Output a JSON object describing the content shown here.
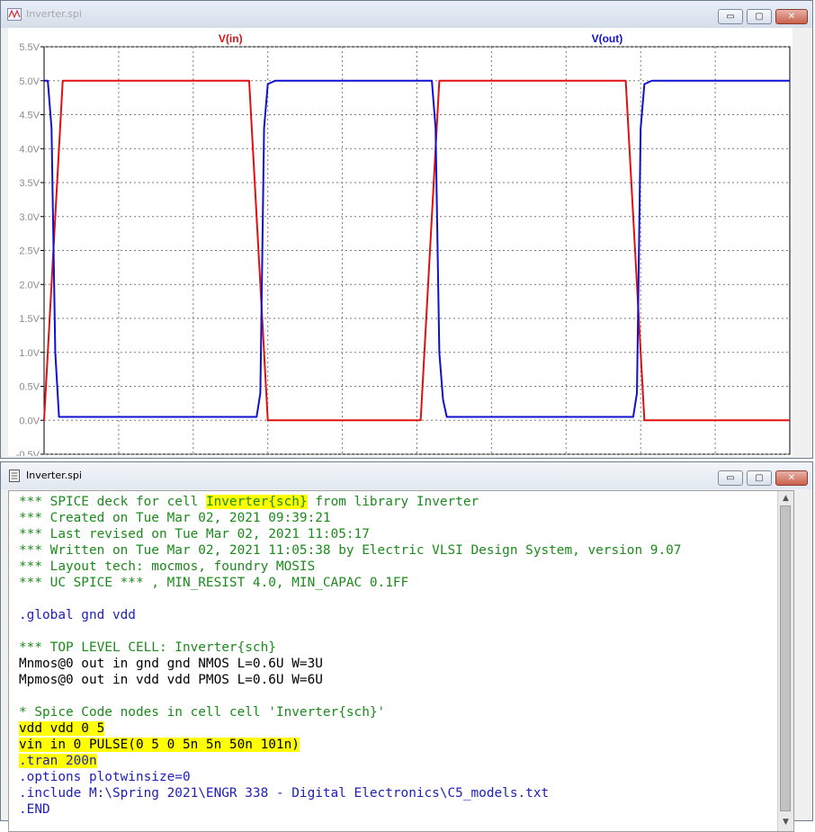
{
  "waveform_window": {
    "title": "Inverter.spi",
    "buttons": {
      "minimize": "▭",
      "restore": "▢",
      "close": "✕"
    },
    "traces": [
      {
        "name": "V(in)",
        "color": "#e01010"
      },
      {
        "name": "V(out)",
        "color": "#1010d0"
      }
    ],
    "background": "#ffffff",
    "grid_color": "#7a7a7a"
  },
  "chart_data": {
    "type": "line",
    "grid": true,
    "x_unit": "ns",
    "xlim": [
      0,
      200
    ],
    "ylim": [
      -0.5,
      5.5
    ],
    "y_ticks": [
      "5.5V",
      "5.0V",
      "4.5V",
      "4.0V",
      "3.5V",
      "3.0V",
      "2.5V",
      "2.0V",
      "1.5V",
      "1.0V",
      "0.5V",
      "0.0V",
      "-0.5V"
    ],
    "y_tick_values": [
      5.5,
      5.0,
      4.5,
      4.0,
      3.5,
      3.0,
      2.5,
      2.0,
      1.5,
      1.0,
      0.5,
      0.0,
      -0.5
    ],
    "x_gridlines": [
      20,
      40,
      60,
      80,
      100,
      120,
      140,
      160,
      180
    ],
    "series": [
      {
        "name": "V(in)",
        "color": "#e01010",
        "x": [
          0,
          5,
          55,
          60,
          101,
          106,
          156,
          161,
          200
        ],
        "y": [
          0,
          5,
          5,
          0,
          0,
          5,
          5,
          0,
          0
        ]
      },
      {
        "name": "V(out)",
        "color": "#1010d0",
        "x": [
          0,
          1,
          2,
          3,
          4,
          57,
          58,
          59,
          60,
          62,
          104,
          105,
          106,
          107,
          108,
          158,
          159,
          160,
          161,
          163,
          200
        ],
        "y": [
          5,
          5,
          4.3,
          1,
          0.05,
          0.05,
          0.4,
          4.3,
          4.95,
          5,
          5,
          4.3,
          1,
          0.3,
          0.05,
          0.05,
          0.4,
          4.3,
          4.95,
          5,
          5
        ]
      }
    ]
  },
  "editor_window": {
    "title": "Inverter.spi",
    "buttons": {
      "minimize": "▭",
      "restore": "▢",
      "close": "✕"
    },
    "scroll_up": "▲",
    "scroll_down": "▼",
    "lines": [
      {
        "style": "comment",
        "parts": [
          {
            "text": "*** SPICE deck for cell "
          },
          {
            "text": "Inverter{sch}",
            "hl": true
          },
          {
            "text": " from library Inverter"
          }
        ]
      },
      {
        "style": "comment",
        "parts": [
          {
            "text": "*** Created on Tue Mar 02, 2021 09:39:21"
          }
        ]
      },
      {
        "style": "comment",
        "parts": [
          {
            "text": "*** Last revised on Tue Mar 02, 2021 11:05:17"
          }
        ]
      },
      {
        "style": "comment",
        "parts": [
          {
            "text": "*** Written on Tue Mar 02, 2021 11:05:38 by Electric VLSI Design System, version 9.07"
          }
        ]
      },
      {
        "style": "comment",
        "parts": [
          {
            "text": "*** Layout tech: mocmos, foundry MOSIS"
          }
        ]
      },
      {
        "style": "comment",
        "parts": [
          {
            "text": "*** UC SPICE *** , MIN_RESIST 4.0, MIN_CAPAC 0.1FF"
          }
        ]
      },
      {
        "style": "plain",
        "parts": [
          {
            "text": ""
          }
        ]
      },
      {
        "style": "dir",
        "parts": [
          {
            "text": ".global gnd vdd"
          }
        ]
      },
      {
        "style": "plain",
        "parts": [
          {
            "text": ""
          }
        ]
      },
      {
        "style": "comment",
        "parts": [
          {
            "text": "*** TOP LEVEL CELL: Inverter{sch}"
          }
        ]
      },
      {
        "style": "plain",
        "parts": [
          {
            "text": "Mnmos@0 out in gnd gnd NMOS L=0.6U W=3U"
          }
        ]
      },
      {
        "style": "plain",
        "parts": [
          {
            "text": "Mpmos@0 out in vdd vdd PMOS L=0.6U W=6U"
          }
        ]
      },
      {
        "style": "plain",
        "parts": [
          {
            "text": ""
          }
        ]
      },
      {
        "style": "comment",
        "parts": [
          {
            "text": "* Spice Code nodes in cell cell 'Inverter{sch}'"
          }
        ]
      },
      {
        "style": "plain",
        "parts": [
          {
            "text": "vdd vdd 0 5",
            "hl": true
          }
        ]
      },
      {
        "style": "plain",
        "parts": [
          {
            "text": "vin in 0 PULSE(0 5 0 5n 5n 50n 101n)",
            "hl": true
          }
        ]
      },
      {
        "style": "dir",
        "parts": [
          {
            "text": ".tran 200n",
            "hl": true
          }
        ]
      },
      {
        "style": "dir",
        "parts": [
          {
            "text": ".options plotwinsize=0"
          }
        ]
      },
      {
        "style": "dir",
        "parts": [
          {
            "text": ".include M:\\Spring 2021\\ENGR 338 - Digital Electronics\\C5_models.txt"
          }
        ]
      },
      {
        "style": "dir",
        "parts": [
          {
            "text": ".END"
          }
        ]
      }
    ]
  }
}
